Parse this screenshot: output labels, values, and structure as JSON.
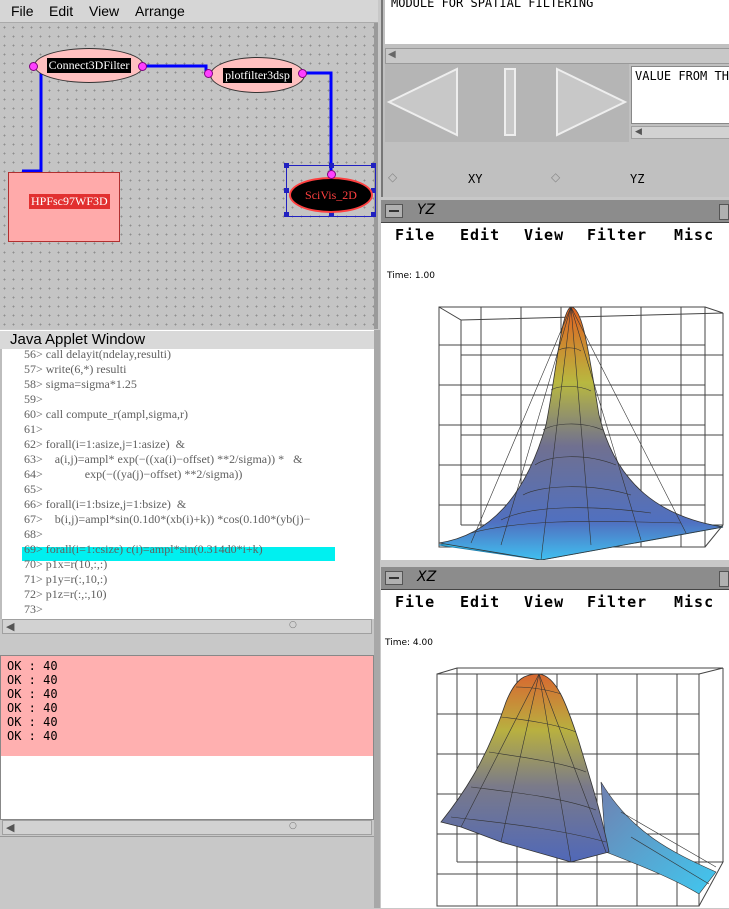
{
  "graph_editor": {
    "menu": [
      "File",
      "Edit",
      "View",
      "Arrange"
    ],
    "nodes": {
      "connect3d": "Connect3DFilter",
      "plotfilter": "plotfilter3dsp",
      "hpf": "HPFsc97WF3D",
      "scivis": "SciVis_2D"
    }
  },
  "applet": {
    "title": "Java Applet Window",
    "code_lines": [
      "56> call delayit(ndelay,resulti)",
      "57> write(6,*) resulti",
      "58> sigma=sigma*1.25",
      "59>",
      "60> call compute_r(ampl,sigma,r)",
      "61>",
      "62> forall(i=1:asize,j=1:asize)  &",
      "63>    a(i,j)=ampl* exp(−((xa(i)−offset) **2/sigma)) *   &",
      "64>              exp(−((ya(j)−offset) **2/sigma))",
      "65>",
      "66> forall(i=1:bsize,j=1:bsize)  &",
      "67>    b(i,j)=ampl*sin(0.1d0*(xb(i)+k)) *cos(0.1d0*(yb(j)−",
      "68>",
      "69> forall(i=1:csize) c(i)=ampl*sin(0.314d0*i+k)",
      "70> p1x=r(10,:,:)",
      "71> p1y=r(:,10,:)",
      "72> p1z=r(:,:,10)",
      "73>"
    ],
    "highlighted_line_index": 13,
    "log_lines": [
      "OK  : 40",
      "OK  : 40",
      "OK  : 40",
      "OK  : 40",
      "OK  : 40",
      "OK  : 40"
    ]
  },
  "module_panel": {
    "title": "MODULE FOR SPATIAL FILTERING",
    "value_text": "VALUE FROM TH",
    "radio_xy": "XY",
    "radio_yz": "YZ"
  },
  "plot_yz": {
    "title": "YZ",
    "menu": [
      "File",
      "Edit",
      "View",
      "Filter",
      "Misc"
    ],
    "time": "Time: 1.00"
  },
  "plot_xz": {
    "title": "XZ",
    "menu": [
      "File",
      "Edit",
      "View",
      "Filter",
      "Misc"
    ],
    "time": "Time: 4.00"
  },
  "colors": {
    "node_fill": "#ffc0c0",
    "scivis_fill": "#000000",
    "scivis_text": "#ff4040",
    "hpf_fill": "#ffaaaa",
    "hpf_label_bg": "#e23030",
    "connection": "#0000ff",
    "port": "#ff40ff",
    "highlight": "#00f0f0",
    "log_bg": "#ffb0b0"
  }
}
